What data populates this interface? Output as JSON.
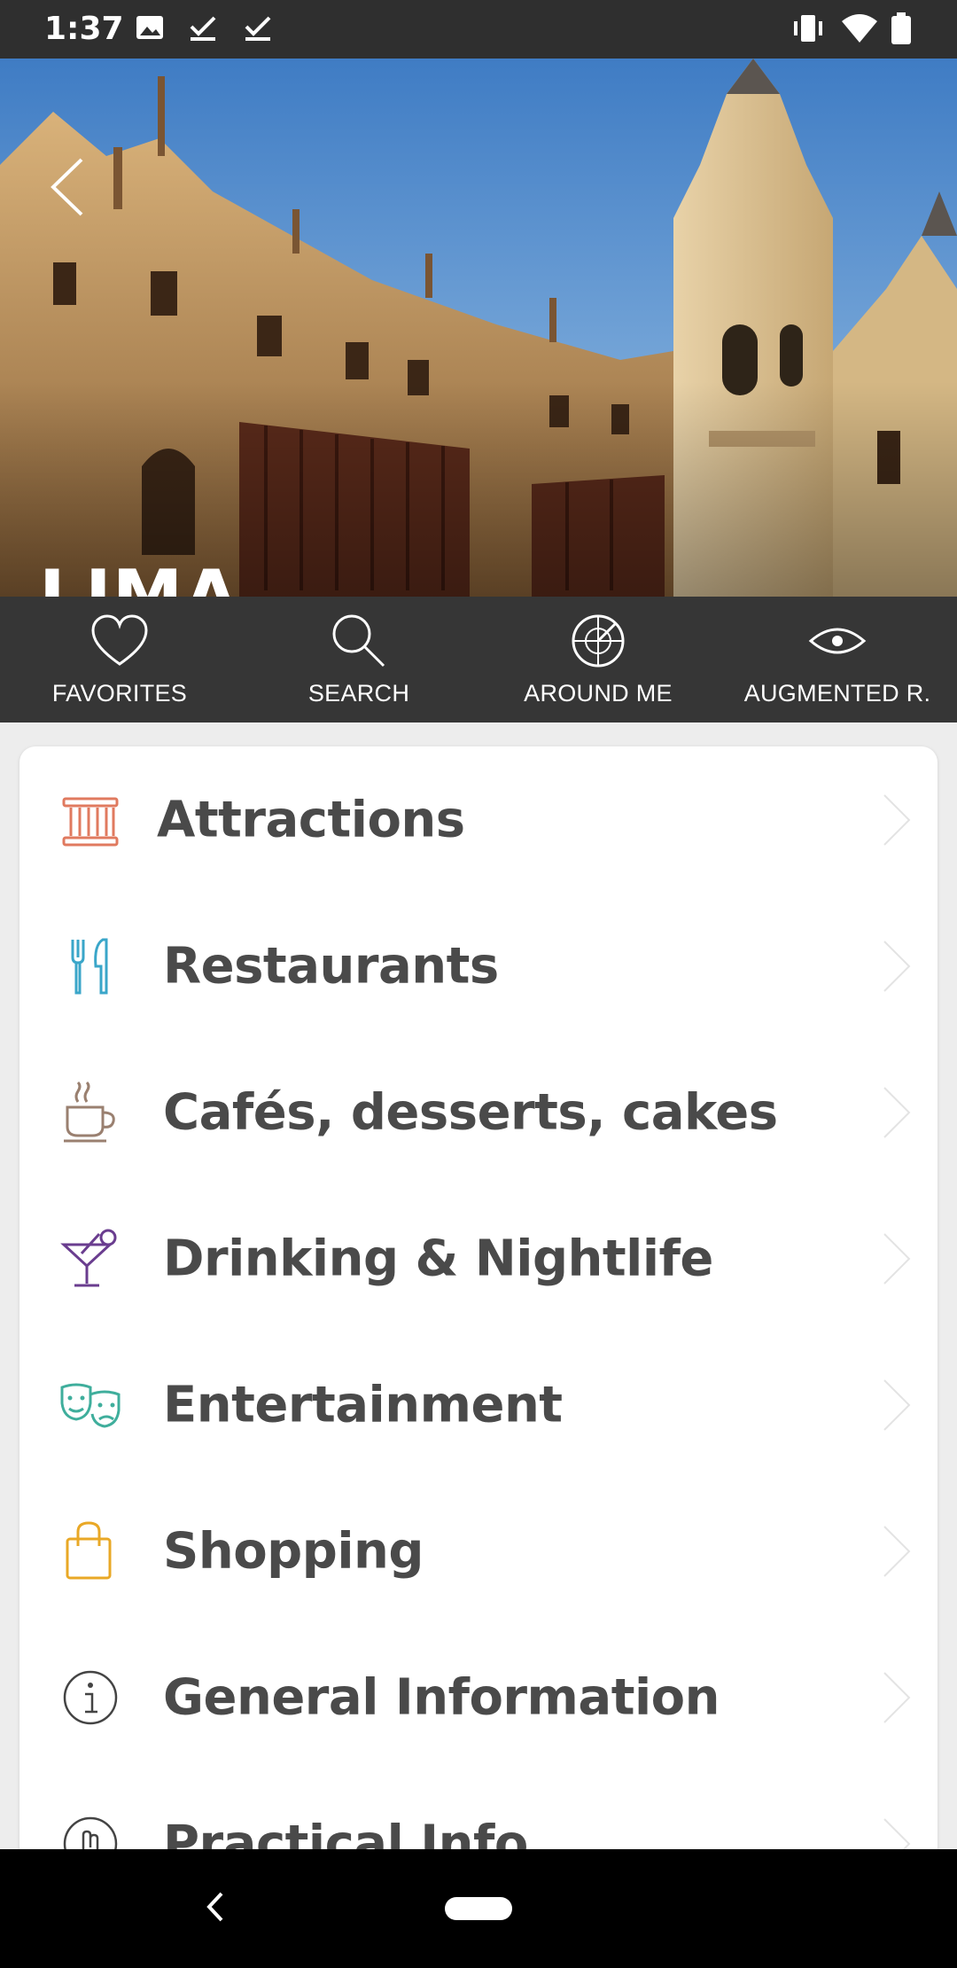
{
  "status_bar": {
    "time": "1:37"
  },
  "hero": {
    "city": "LIMA"
  },
  "tabs": [
    {
      "label": "FAVORITES",
      "icon": "heart-icon"
    },
    {
      "label": "SEARCH",
      "icon": "search-icon"
    },
    {
      "label": "AROUND ME",
      "icon": "radar-icon"
    },
    {
      "label": "AUGMENTED R.",
      "icon": "eye-icon"
    }
  ],
  "categories": [
    {
      "label": "Attractions",
      "icon": "museum-icon",
      "color": "#e07a5f"
    },
    {
      "label": "Restaurants",
      "icon": "cutlery-icon",
      "color": "#3aa6c9"
    },
    {
      "label": "Cafés, desserts, cakes",
      "icon": "coffee-cup-icon",
      "color": "#9a8070"
    },
    {
      "label": "Drinking & Nightlife",
      "icon": "cocktail-icon",
      "color": "#6a3d8f"
    },
    {
      "label": "Entertainment",
      "icon": "theater-masks-icon",
      "color": "#3fae9c"
    },
    {
      "label": "Shopping",
      "icon": "shopping-bag-icon",
      "color": "#e9a826"
    },
    {
      "label": "General Information",
      "icon": "info-icon",
      "color": "#444444"
    },
    {
      "label": "Practical Info",
      "icon": "hand-icon",
      "color": "#444444"
    }
  ]
}
